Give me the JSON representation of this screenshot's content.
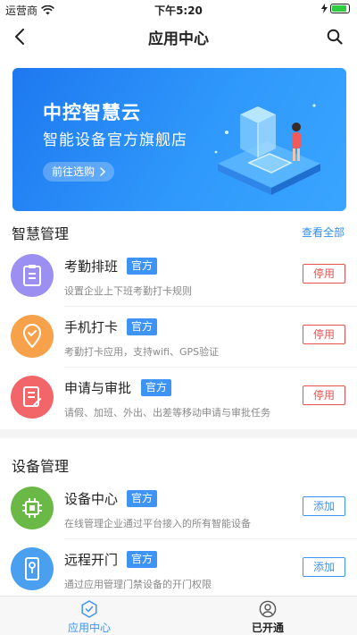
{
  "status_bar": {
    "carrier": "运营商",
    "time": "下午5:20",
    "battery_level": 0.9
  },
  "navbar": {
    "title": "应用中心"
  },
  "banner": {
    "title": "中控智慧云",
    "subtitle": "智能设备官方旗舰店",
    "button_label": "前往选购"
  },
  "sections": [
    {
      "title": "智慧管理",
      "more_label": "查看全部",
      "items": [
        {
          "name": "考勤排班",
          "badge": "官方",
          "desc": "设置企业上下班考勤打卡规则",
          "action": "停用",
          "icon": "clipboard-icon",
          "color": "#9b8ff2"
        },
        {
          "name": "手机打卡",
          "badge": "官方",
          "desc": "考勤打卡应用，支持wifi、GPS验证",
          "action": "停用",
          "icon": "location-check-icon",
          "color": "#f7a14b"
        },
        {
          "name": "申请与审批",
          "badge": "官方",
          "desc": "请假、加班、外出、出差等移动申请与审批任务",
          "action": "停用",
          "icon": "document-edit-icon",
          "color": "#f2666a"
        }
      ]
    },
    {
      "title": "设备管理",
      "items": [
        {
          "name": "设备中心",
          "badge": "官方",
          "desc": "在线管理企业通过平台接入的所有智能设备",
          "action": "添加",
          "icon": "chip-icon",
          "color": "#6ab845"
        },
        {
          "name": "远程开门",
          "badge": "官方",
          "desc": "通过应用管理门禁设备的开门权限",
          "action": "添加",
          "icon": "door-phone-icon",
          "color": "#4aa0ef"
        }
      ]
    }
  ],
  "tabs": [
    {
      "label": "应用中心",
      "icon": "app-center-icon",
      "active": true
    },
    {
      "label": "已开通",
      "icon": "user-circle-icon",
      "active": false
    }
  ],
  "colors": {
    "accent": "#3d94f6",
    "stop": "#e65151"
  }
}
